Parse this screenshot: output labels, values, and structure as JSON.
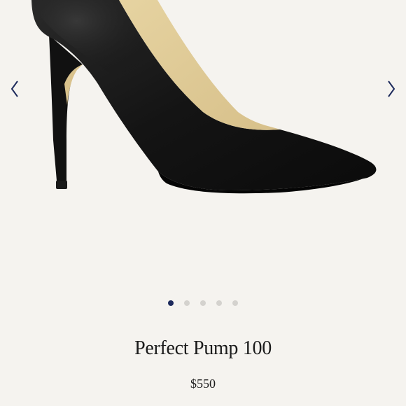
{
  "product": {
    "title": "Perfect Pump 100",
    "price": "$550"
  },
  "gallery": {
    "image_count": 5,
    "active_index": 0,
    "prev_icon": "chevron-left-icon",
    "next_icon": "chevron-right-icon",
    "image_subject": "black leather pointed-toe stiletto pump"
  },
  "colors": {
    "background": "#f5f3ef",
    "arrow": "#1d2a5c",
    "dot_active": "#1d2a5c",
    "dot_inactive": "#d4d2ce",
    "text": "#1b1b1b"
  }
}
